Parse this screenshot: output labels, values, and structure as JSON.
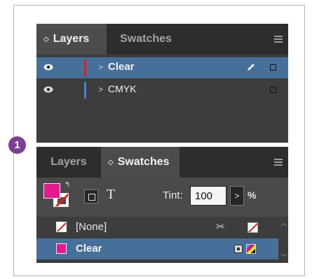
{
  "layers_panel": {
    "tabs": [
      {
        "label": "Layers",
        "active": true
      },
      {
        "label": "Swatches",
        "active": false
      }
    ],
    "rows": [
      {
        "name": "Clear",
        "color": "#d8261d",
        "selected": true
      },
      {
        "name": "CMYK",
        "color": "#4a84c8",
        "selected": false
      }
    ]
  },
  "swatches_panel": {
    "tabs": [
      {
        "label": "Layers",
        "active": false
      },
      {
        "label": "Swatches",
        "active": true
      }
    ],
    "tint_label": "Tint:",
    "tint_value": "100",
    "tint_unit": "%",
    "text_icon_glyph": "T",
    "swatches": [
      {
        "name": "[None]",
        "selected": false
      },
      {
        "name": "Clear",
        "selected": true
      }
    ]
  },
  "callout": {
    "number": "1",
    "color": "#7c3f93"
  },
  "colors": {
    "selection": "#466f9a",
    "panel_bg": "#3d3d3d",
    "tabbar_bg": "#2d2d2d",
    "magenta": "#e8178f"
  },
  "icons": [
    "eye-icon",
    "pencil-icon",
    "panel-menu-icon",
    "scissors-no-edit-icon",
    "spot-color-icon",
    "cmyk-process-icon"
  ]
}
